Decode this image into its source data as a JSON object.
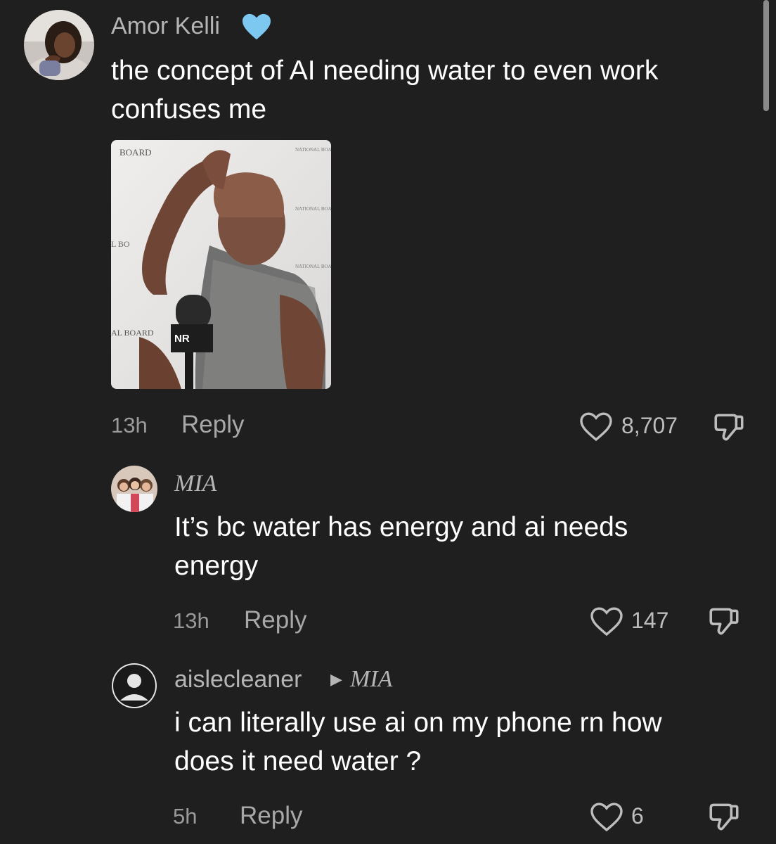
{
  "comments": [
    {
      "username": "Amor Kelli",
      "badge": "blue-heart",
      "text": "the concept of AI needing water to even work\nconfuses me",
      "time": "13h",
      "reply_label": "Reply",
      "likes": "8,707",
      "has_image": true
    },
    {
      "username": "MIA",
      "text": "It’s bc water has energy and ai needs\nenergy",
      "time": "13h",
      "reply_label": "Reply",
      "likes": "147"
    },
    {
      "username": "aislecleaner",
      "replying_to": "MIA",
      "text": "i can literally use ai on my phone rn how\ndoes it need water ?",
      "time": "5h",
      "reply_label": "Reply",
      "likes": "6"
    }
  ],
  "colors": {
    "background": "#1f1f1f",
    "heart_badge": "#7cc8f0",
    "muted_text": "#b5b5b5"
  },
  "icons": [
    "blue-heart-icon",
    "heart-outline-icon",
    "thumbs-down-icon"
  ]
}
